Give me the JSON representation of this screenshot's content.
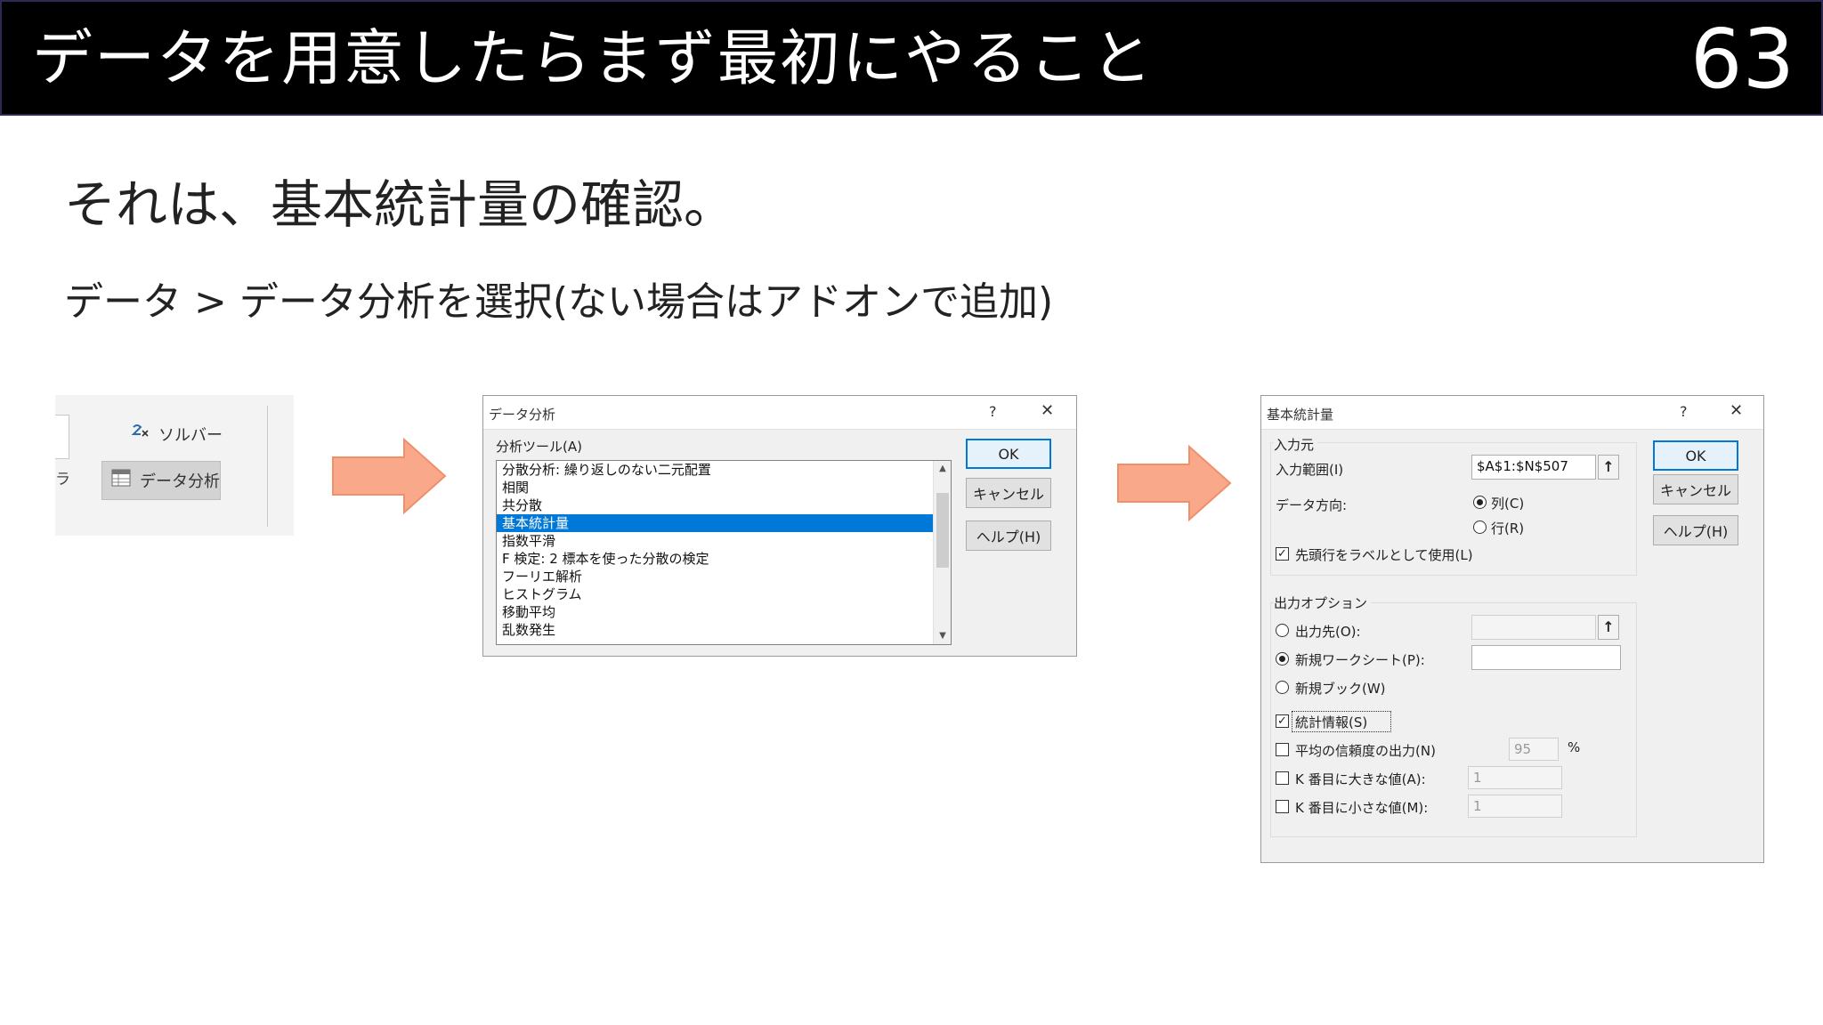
{
  "slide": {
    "title": "データを用意したらまず最初にやること",
    "page_number": "63",
    "subtitle": "それは、基本統計量の確認。",
    "instruction": "データ > データ分析を選択(ない場合はアドオンで追加)"
  },
  "ribbon": {
    "solver_label": "ソルバー",
    "analysis_label": "データ分析",
    "left_stub": "ラ"
  },
  "colors": {
    "title_bg": "#000000",
    "arrow_fill": "#F9A98A",
    "selection": "#0078D7"
  },
  "analysis_dialog": {
    "title": "データ分析",
    "help_glyph": "?",
    "close_glyph": "✕",
    "tools_label": "分析ツール(A)",
    "tools": [
      "分散分析: 繰り返しのない二元配置",
      "相関",
      "共分散",
      "基本統計量",
      "指数平滑",
      "F 検定: 2 標本を使った分散の検定",
      "フーリエ解析",
      "ヒストグラム",
      "移動平均",
      "乱数発生"
    ],
    "selected_index": 3,
    "ok_label": "OK",
    "cancel_label": "キャンセル",
    "help_label": "ヘルプ(H)"
  },
  "stats_dialog": {
    "title": "基本統計量",
    "help_glyph": "?",
    "close_glyph": "✕",
    "input_group_label": "入力元",
    "input_range_label": "入力範囲(I)",
    "input_range_value": "$A$1:$N$507",
    "direction_label": "データ方向:",
    "direction_column": "列(C)",
    "direction_row": "行(R)",
    "labels_first_row": "先頭行をラベルとして使用(L)",
    "output_group_label": "出力オプション",
    "output_range_label": "出力先(O):",
    "new_sheet_label": "新規ワークシート(P):",
    "new_book_label": "新規ブック(W)",
    "summary_stats_label": "統計情報(S)",
    "confidence_label": "平均の信頼度の出力(N)",
    "confidence_value": "95",
    "percent_sign": "%",
    "kth_largest_label": "K 番目に大きな値(A):",
    "kth_largest_value": "1",
    "kth_smallest_label": "K 番目に小さな値(M):",
    "kth_smallest_value": "1",
    "ok_label": "OK",
    "cancel_label": "キャンセル",
    "help_label": "ヘルプ(H)",
    "ref_glyph": "↑"
  }
}
